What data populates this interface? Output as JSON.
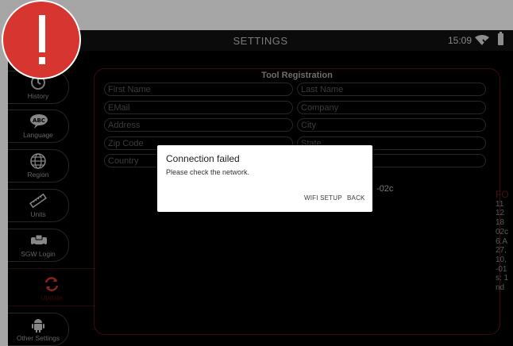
{
  "header": {
    "title": "SETTINGS",
    "clock": "15:09",
    "wifi_icon": "wifi-off-icon",
    "battery_icon": "battery-icon"
  },
  "sidebar": {
    "items": [
      {
        "label": "History",
        "icon": "history-icon"
      },
      {
        "label": "Language",
        "icon": "language-abc-icon"
      },
      {
        "label": "Region",
        "icon": "globe-icon"
      },
      {
        "label": "Units",
        "icon": "ruler-icon"
      },
      {
        "label": "SGW Login",
        "icon": "sgw-car-icon"
      },
      {
        "label": "Update",
        "icon": "update-icon"
      },
      {
        "label": "Other Settings",
        "icon": "android-icon"
      }
    ]
  },
  "registration": {
    "title": "Tool Registration",
    "fields": {
      "first_name": "First Name",
      "last_name": "Last Name",
      "email": "EMail",
      "company": "Company",
      "address": "Address",
      "city": "City",
      "zip": "Zip Code",
      "state": "State",
      "country": "Country",
      "phone": ""
    },
    "partial_value": "-02c"
  },
  "info_column": {
    "header": "FO",
    "lines": [
      "11",
      "12",
      "18",
      "02c",
      "6.A",
      "27,",
      "10,",
      "-01",
      "s: 1",
      "nd"
    ]
  },
  "dialog": {
    "title": "Connection failed",
    "message": "Please check the network.",
    "wifi_button": "WIFI SETUP",
    "back_button": "BACK"
  },
  "colors": {
    "accent": "#d6362f",
    "panel_border": "#5e1414",
    "background": "#000000"
  }
}
